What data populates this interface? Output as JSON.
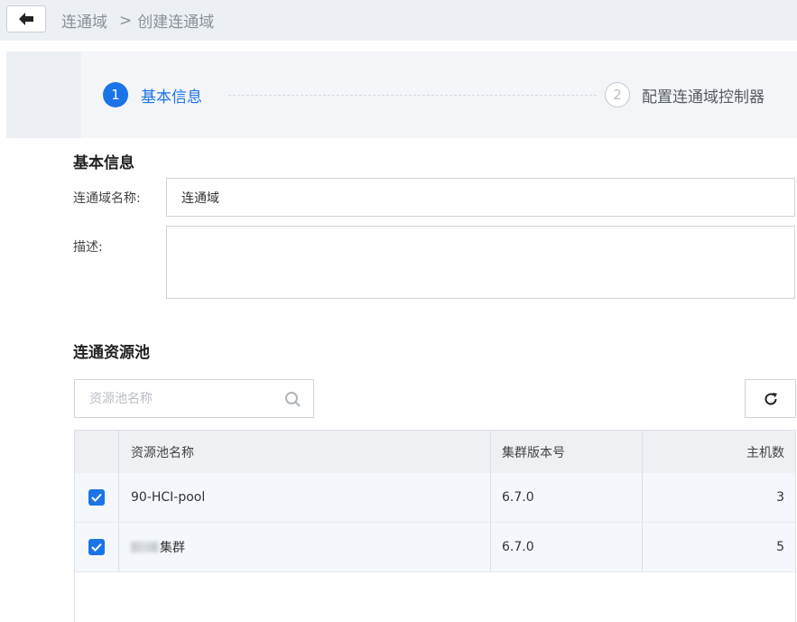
{
  "breadcrumb": {
    "root": "连通域",
    "separator": ">",
    "current": "创建连通域"
  },
  "steps": [
    {
      "number": "1",
      "label": "基本信息",
      "state": "active"
    },
    {
      "number": "2",
      "label": "配置连通域控制器",
      "state": "pending"
    }
  ],
  "basic_info": {
    "title": "基本信息",
    "name_label": "连通域名称:",
    "name_value": "连通域",
    "desc_label": "描述:",
    "desc_value": ""
  },
  "pool": {
    "title": "连通资源池",
    "search_placeholder": "资源池名称",
    "columns": [
      "资源池名称",
      "集群版本号",
      "主机数"
    ],
    "rows": [
      {
        "checked": true,
        "name": "90-HCI-pool",
        "version": "6.7.0",
        "hosts": "3"
      },
      {
        "checked": true,
        "name": "集群",
        "name_redacted_prefix": true,
        "version": "6.7.0",
        "hosts": "5"
      }
    ]
  },
  "colors": {
    "accent": "#1a74e8",
    "topbar_bg": "#eceff3",
    "steps_bg": "#f3f5f8",
    "row_bg": "#f4f8fd"
  },
  "icons": {
    "back": "arrow-left-icon",
    "search": "search-icon",
    "refresh": "refresh-icon",
    "check": "check-icon"
  }
}
